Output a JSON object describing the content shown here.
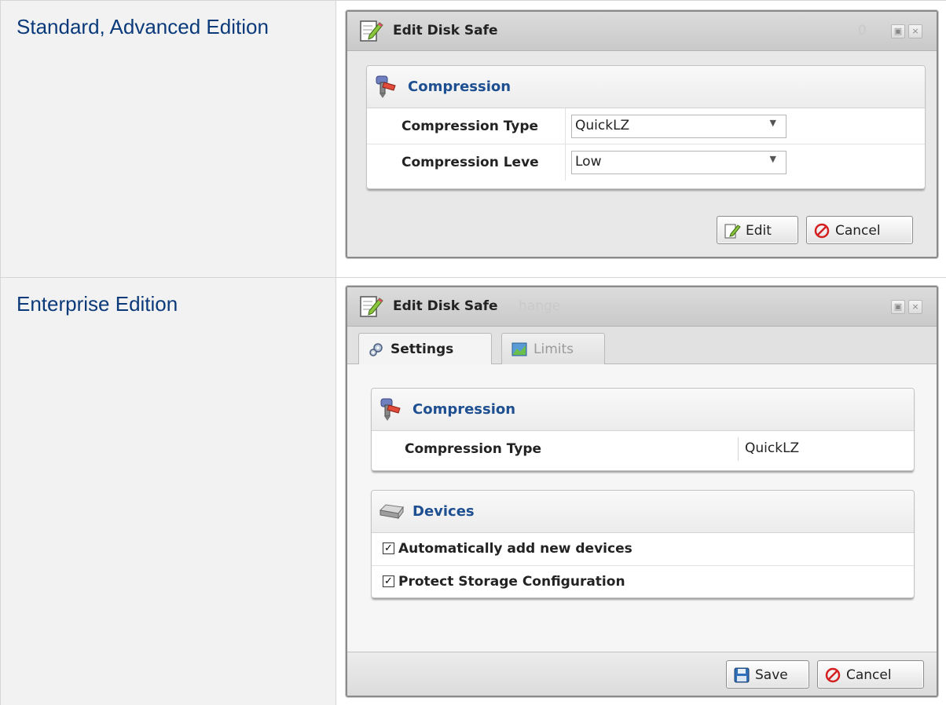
{
  "rows": [
    {
      "label": "Standard, Advanced Edition",
      "dialog": {
        "title": "Edit Disk Safe",
        "sections": {
          "compression": {
            "title": "Compression",
            "fields": [
              {
                "label": "Compression Type",
                "value": "QuickLZ"
              },
              {
                "label": "Compression Leve",
                "value": "Low"
              }
            ]
          }
        },
        "buttons": {
          "edit": "Edit",
          "cancel": "Cancel"
        }
      }
    },
    {
      "label": "Enterprise Edition",
      "dialog": {
        "title": "Edit Disk Safe",
        "ghost_title": "hange",
        "tabs": [
          {
            "label": "Settings",
            "active": true
          },
          {
            "label": "Limits",
            "active": false
          }
        ],
        "sections": {
          "compression": {
            "title": "Compression",
            "fields": [
              {
                "label": "Compression Type",
                "value": "QuickLZ"
              }
            ]
          },
          "devices": {
            "title": "Devices",
            "options": [
              {
                "label": "Automatically add new devices",
                "checked": true
              },
              {
                "label": "Protect Storage Configuration",
                "checked": true
              }
            ]
          }
        },
        "buttons": {
          "save": "Save",
          "cancel": "Cancel"
        }
      }
    }
  ],
  "colors": {
    "label_text": "#0b3a7a",
    "section_title": "#1d4f91",
    "label_cell_bg": "#f2f2f2"
  },
  "icons": [
    "edit-note-icon",
    "compression-icon",
    "settings-gears-icon",
    "limits-chart-icon",
    "devices-disk-icon",
    "save-floppy-icon",
    "cancel-circle-icon"
  ]
}
